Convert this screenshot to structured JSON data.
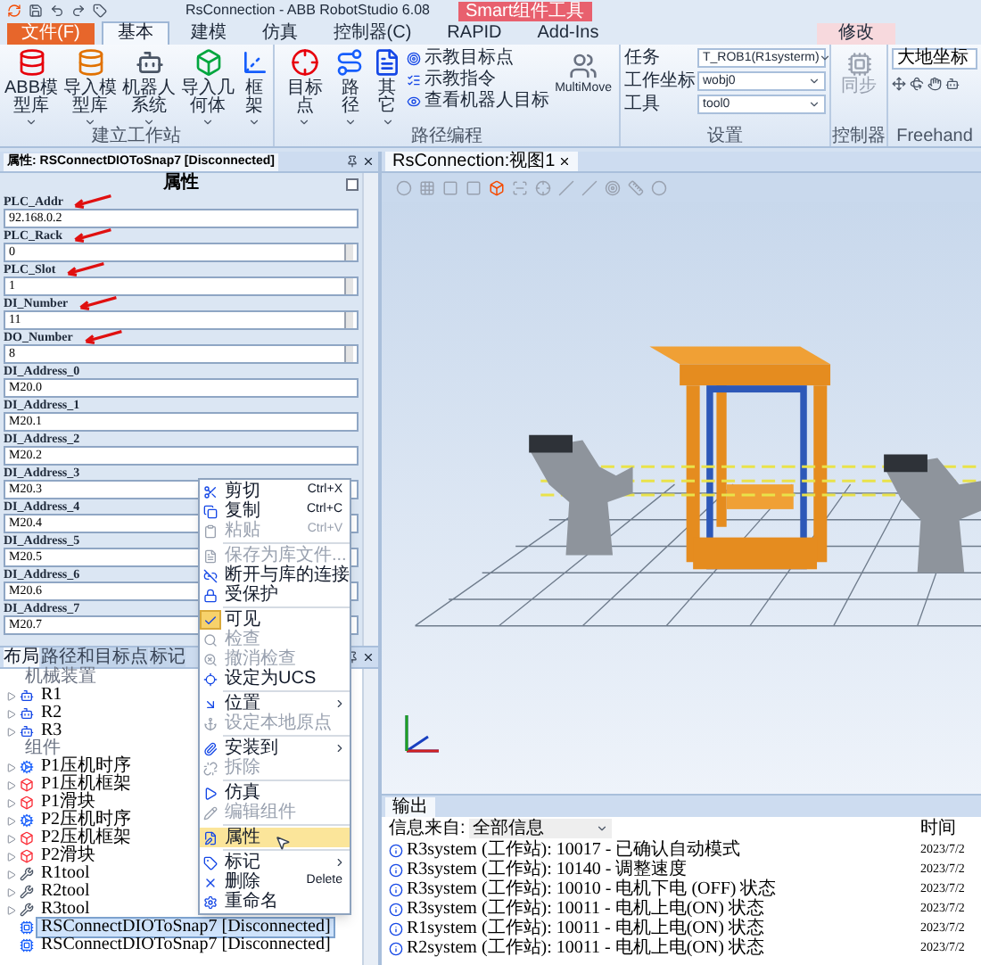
{
  "title_bar": {
    "title": "RsConnection - ABB RobotStudio 6.08",
    "context_label": "Smart组件工具"
  },
  "ribbon_tabs": [
    {
      "label": "文件(F)",
      "kind": "file",
      "selected": false
    },
    {
      "label": "基本",
      "kind": "tab",
      "selected": true
    },
    {
      "label": "建模",
      "kind": "tab",
      "selected": false
    },
    {
      "label": "仿真",
      "kind": "tab",
      "selected": false
    },
    {
      "label": "控制器(C)",
      "kind": "tab",
      "selected": false
    },
    {
      "label": "RAPID",
      "kind": "tab",
      "selected": false
    },
    {
      "label": "Add-Ins",
      "kind": "tab",
      "selected": false
    },
    {
      "label": "修改",
      "kind": "context",
      "selected": false
    }
  ],
  "ribbon": {
    "build": {
      "label": "建立工作站",
      "buttons": [
        "ABB模型库",
        "导入模型库",
        "机器人系统",
        "导入几何体",
        "框架"
      ]
    },
    "path": {
      "label": "路径编程",
      "buttons": [
        "目标点",
        "路径",
        "其它"
      ],
      "list": [
        "示教目标点",
        "示教指令",
        "查看机器人目标"
      ],
      "multimove": "MultiMove"
    },
    "settings": {
      "label": "设置",
      "fields": [
        {
          "label": "任务",
          "value": "T_ROB1(R1systerm)"
        },
        {
          "label": "工作坐标",
          "value": "wobj0"
        },
        {
          "label": "工具",
          "value": "tool0"
        }
      ]
    },
    "controller": {
      "label": "控制器",
      "button": "同步",
      "disabled": true
    },
    "freehand": {
      "label": "Freehand",
      "dropdown": "大地坐标"
    }
  },
  "properties_panel": {
    "title": "属性: RSConnectDIOToSnap7 [Disconnected]",
    "heading": "属性",
    "fields": [
      {
        "label": "PLC_Addr",
        "value": "92.168.0.2",
        "kind": "text",
        "marked": true
      },
      {
        "label": "PLC_Rack",
        "value": "0",
        "kind": "spin",
        "marked": true
      },
      {
        "label": "PLC_Slot",
        "value": "1",
        "kind": "spin",
        "marked": true
      },
      {
        "label": "DI_Number",
        "value": "11",
        "kind": "spin",
        "marked": true
      },
      {
        "label": "DO_Number",
        "value": "8",
        "kind": "spin",
        "marked": true
      },
      {
        "label": "DI_Address_0",
        "value": "M20.0",
        "kind": "text",
        "marked": false
      },
      {
        "label": "DI_Address_1",
        "value": "M20.1",
        "kind": "text",
        "marked": false
      },
      {
        "label": "DI_Address_2",
        "value": "M20.2",
        "kind": "text",
        "marked": false
      },
      {
        "label": "DI_Address_3",
        "value": "M20.3",
        "kind": "text",
        "marked": false
      },
      {
        "label": "DI_Address_4",
        "value": "M20.4",
        "kind": "text",
        "marked": false
      },
      {
        "label": "DI_Address_5",
        "value": "M20.5",
        "kind": "text",
        "marked": false
      },
      {
        "label": "DI_Address_6",
        "value": "M20.6",
        "kind": "text",
        "marked": false
      },
      {
        "label": "DI_Address_7",
        "value": "M20.7",
        "kind": "text",
        "marked": false
      }
    ]
  },
  "layout_panel": {
    "tabs": [
      {
        "label": "布局",
        "selected": true
      },
      {
        "label": "路径和目标点",
        "selected": false
      },
      {
        "label": "标记",
        "selected": false
      }
    ],
    "rows": [
      {
        "label": "机械装置",
        "kind": "header",
        "selected": false
      },
      {
        "label": "R1",
        "kind": "robot",
        "selected": false
      },
      {
        "label": "R2",
        "kind": "robot",
        "selected": false
      },
      {
        "label": "R3",
        "kind": "robot",
        "selected": false
      },
      {
        "label": "组件",
        "kind": "header",
        "selected": false
      },
      {
        "label": "P1压机时序",
        "kind": "logic",
        "selected": false
      },
      {
        "label": "P1压机框架",
        "kind": "part",
        "selected": false
      },
      {
        "label": "P1滑块",
        "kind": "part",
        "selected": false
      },
      {
        "label": "P2压机时序",
        "kind": "logic",
        "selected": false
      },
      {
        "label": "P2压机框架",
        "kind": "part",
        "selected": false
      },
      {
        "label": "P2滑块",
        "kind": "part",
        "selected": false
      },
      {
        "label": "R1tool",
        "kind": "tool",
        "selected": false
      },
      {
        "label": "R2tool",
        "kind": "tool",
        "selected": false
      },
      {
        "label": "R3tool",
        "kind": "tool",
        "selected": false
      },
      {
        "label": "RSConnectDIOToSnap7 [Disconnected]",
        "kind": "smart",
        "selected": true
      },
      {
        "label": "RSConnectDIOToSnap7 [Disconnected]",
        "kind": "smart",
        "selected": false
      }
    ]
  },
  "context_menu": [
    {
      "kind": "item",
      "label": "剪切",
      "shortcut": "Ctrl+X",
      "disabled": false,
      "checked": false,
      "selected": false
    },
    {
      "kind": "item",
      "label": "复制",
      "shortcut": "Ctrl+C",
      "disabled": false,
      "checked": false,
      "selected": false
    },
    {
      "kind": "item",
      "label": "粘贴",
      "shortcut": "Ctrl+V",
      "disabled": true,
      "checked": false,
      "selected": false
    },
    {
      "kind": "separator"
    },
    {
      "kind": "item",
      "label": "保存为库文件...",
      "disabled": true,
      "checked": false,
      "selected": false
    },
    {
      "kind": "item",
      "label": "断开与库的连接",
      "disabled": false,
      "checked": false,
      "selected": false
    },
    {
      "kind": "item",
      "label": "受保护",
      "disabled": false,
      "checked": false,
      "selected": false
    },
    {
      "kind": "separator"
    },
    {
      "kind": "item",
      "label": "可见",
      "disabled": false,
      "checked": true,
      "selected": false
    },
    {
      "kind": "item",
      "label": "检查",
      "disabled": true,
      "checked": false,
      "selected": false
    },
    {
      "kind": "item",
      "label": "撤消检查",
      "disabled": true,
      "checked": false,
      "selected": false
    },
    {
      "kind": "item",
      "label": "设定为UCS",
      "disabled": false,
      "checked": false,
      "selected": false
    },
    {
      "kind": "separator"
    },
    {
      "kind": "submenu",
      "label": "位置",
      "disabled": false,
      "checked": false,
      "selected": false
    },
    {
      "kind": "item",
      "label": "设定本地原点",
      "disabled": true,
      "checked": false,
      "selected": false
    },
    {
      "kind": "separator"
    },
    {
      "kind": "submenu",
      "label": "安装到",
      "disabled": false,
      "checked": false,
      "selected": false
    },
    {
      "kind": "item",
      "label": "拆除",
      "disabled": true,
      "checked": false,
      "selected": false
    },
    {
      "kind": "separator"
    },
    {
      "kind": "item",
      "label": "仿真",
      "disabled": false,
      "checked": false,
      "selected": false
    },
    {
      "kind": "item",
      "label": "编辑组件",
      "disabled": true,
      "checked": false,
      "selected": false
    },
    {
      "kind": "separator"
    },
    {
      "kind": "item",
      "label": "属性",
      "disabled": false,
      "checked": false,
      "selected": true
    },
    {
      "kind": "separator"
    },
    {
      "kind": "submenu",
      "label": "标记",
      "disabled": false,
      "checked": false,
      "selected": false
    },
    {
      "kind": "item",
      "label": "删除",
      "shortcut": "Delete",
      "disabled": false,
      "checked": false,
      "selected": false
    },
    {
      "kind": "item",
      "label": "重命名",
      "disabled": false,
      "checked": false,
      "selected": false
    }
  ],
  "viewport": {
    "tab": "RsConnection:视图1"
  },
  "output_panel": {
    "tab": "输出",
    "filter_label": "信息来自:",
    "filter_value": "全部信息",
    "time_heading": "时间",
    "rows": [
      {
        "message": "R3system (工作站): 10017 - 已确认自动模式",
        "time": "2023/7/2"
      },
      {
        "message": "R3system (工作站): 10140 - 调整速度",
        "time": "2023/7/2"
      },
      {
        "message": "R3system (工作站): 10010 - 电机下电 (OFF) 状态",
        "time": "2023/7/2"
      },
      {
        "message": "R3system (工作站): 10011 - 电机上电(ON) 状态",
        "time": "2023/7/2"
      },
      {
        "message": "R1system (工作站): 10011 - 电机上电(ON) 状态",
        "time": "2023/7/2"
      },
      {
        "message": "R2system (工作站): 10011 - 电机上电(ON) 状态",
        "time": "2023/7/2"
      }
    ]
  }
}
